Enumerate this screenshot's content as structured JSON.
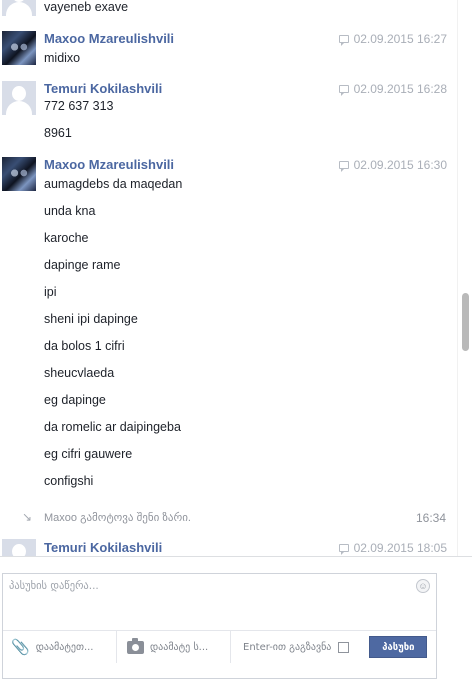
{
  "chat": {
    "top_partial_text": "vayeneb exave",
    "groups": [
      {
        "author": "Maxoo Mzareulishvili",
        "timestamp": "02.09.2015 16:27",
        "avatar": "photo",
        "messages": [
          "midixo"
        ]
      },
      {
        "author": "Temuri Kokilashvili",
        "timestamp": "02.09.2015 16:28",
        "avatar": "default",
        "messages": [
          "772 637 313",
          "8961"
        ]
      },
      {
        "author": "Maxoo Mzareulishvili",
        "timestamp": "02.09.2015 16:30",
        "avatar": "photo",
        "messages": [
          "aumagdebs da maqedan",
          "unda kna",
          "karoche",
          "dapinge rame",
          "ipi",
          "sheni ipi dapinge",
          "da bolos 1 cifri",
          "sheucvlaeda",
          "eg dapinge",
          "da romelic ar daipingeba",
          "eg cifri gauwere",
          "configshi"
        ]
      },
      {
        "author": "Temuri Kokilashvili",
        "timestamp": "02.09.2015 18:05",
        "avatar": "default",
        "messages": []
      }
    ],
    "system_event": {
      "text": "Maxoo გამოტოვა შენი ზარი.",
      "time": "16:34",
      "icon": "missed-call-icon"
    }
  },
  "composer": {
    "placeholder": "პასუხის დაწერა...",
    "add_files": "დაამატეთ...",
    "add_photo": "დაამატე ს...",
    "enter_to_send": "Enter-ით გაგზავნა",
    "send_label": "პასუხი"
  },
  "colors": {
    "author": "#4b67a1",
    "send_button": "#4e69a2",
    "timestamp": "#a9aeb7"
  }
}
